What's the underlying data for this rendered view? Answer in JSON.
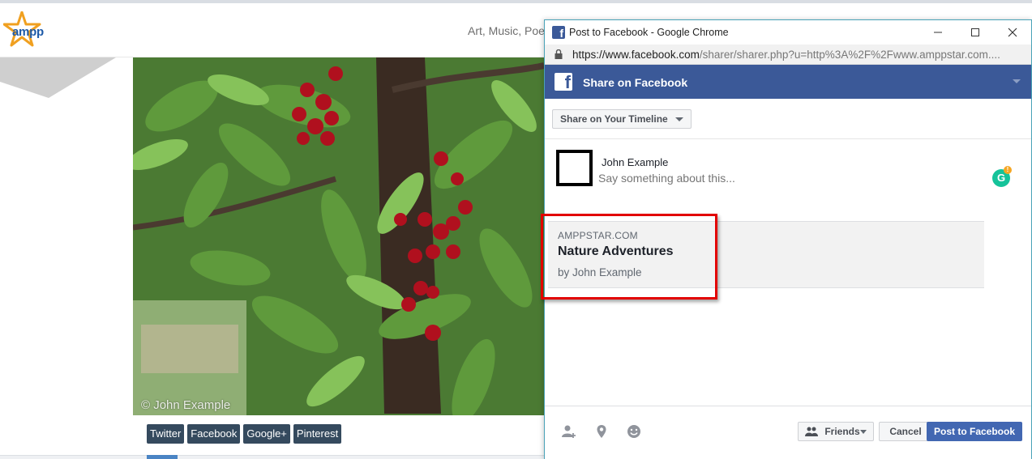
{
  "site": {
    "logo_text": "ampp",
    "nav_text": "Art, Music, Poe",
    "photo_credit": "© John Example",
    "share_buttons": [
      "Twitter",
      "Facebook",
      "Google+",
      "Pinterest"
    ]
  },
  "window": {
    "title": "Post to Facebook - Google Chrome",
    "url_host": "https://www.facebook.com",
    "url_rest": "/sharer/sharer.php?u=http%3A%2F%2Fwww.amppstar.com...."
  },
  "facebook": {
    "header_title": "Share on Facebook",
    "timeline_dropdown": "Share on Your Timeline",
    "user_name": "John Example",
    "composer_placeholder": "Say something about this...",
    "preview": {
      "domain": "AMPPSTAR.COM",
      "title": "Nature Adventures",
      "author": "by John Example"
    },
    "footer": {
      "friends_label": "Friends",
      "cancel_label": "Cancel",
      "post_label": "Post to Facebook"
    }
  },
  "colors": {
    "facebook_blue": "#3b5998",
    "post_button": "#4267b2",
    "highlight_red": "#e20000",
    "share_button": "#354a5e"
  }
}
